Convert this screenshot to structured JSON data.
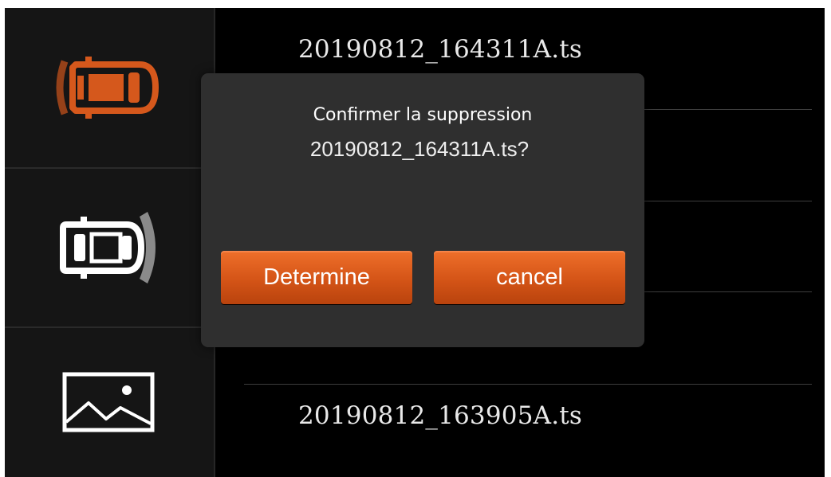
{
  "sidebar": {
    "items": [
      {
        "name": "front-camera",
        "icon": "car-front-sensor-icon",
        "color": "#d5581c",
        "active": true
      },
      {
        "name": "rear-camera",
        "icon": "car-rear-sensor-icon",
        "color": "#ffffff",
        "active": false
      },
      {
        "name": "photos",
        "icon": "image-gallery-icon",
        "color": "#ffffff",
        "active": false
      }
    ]
  },
  "file_list": {
    "items": [
      {
        "filename": "20190812_164311A.ts"
      },
      {
        "filename": "20190812_163905A.ts"
      }
    ]
  },
  "dialog": {
    "title": "Confirmer la suppression",
    "message": "20190812_164311A.ts?",
    "confirm_label": "Determine",
    "cancel_label": "cancel"
  },
  "colors": {
    "accent": "#d5581c",
    "dialog_bg": "#2f2f2f",
    "background": "#000000"
  }
}
